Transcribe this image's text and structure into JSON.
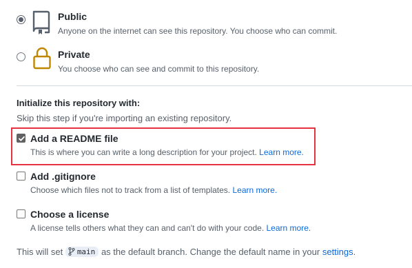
{
  "visibility": {
    "options": [
      {
        "title": "Public",
        "description": "Anyone on the internet can see this repository. You choose who can commit.",
        "selected": true,
        "icon": "repo-icon"
      },
      {
        "title": "Private",
        "description": "You choose who can see and commit to this repository.",
        "selected": false,
        "icon": "lock-icon"
      }
    ]
  },
  "initialize": {
    "heading": "Initialize this repository with:",
    "subheading": "Skip this step if you're importing an existing repository.",
    "readme": {
      "label": "Add a README file",
      "description": "This is where you can write a long description for your project.",
      "link": "Learn more.",
      "checked": true
    },
    "gitignore": {
      "label": "Add .gitignore",
      "description": "Choose which files not to track from a list of templates.",
      "link": "Learn more.",
      "checked": false
    },
    "license": {
      "label": "Choose a license",
      "description": "A license tells others what they can and can't do with your code.",
      "link": "Learn more.",
      "checked": false
    }
  },
  "footer": {
    "prefix": "This will set",
    "branch": "main",
    "suffix": "as the default branch. Change the default name in your",
    "settings_link": "settings",
    "end": "."
  },
  "colors": {
    "highlight": "#e5323e",
    "link": "#0969da",
    "lock_icon": "#bf8700"
  }
}
